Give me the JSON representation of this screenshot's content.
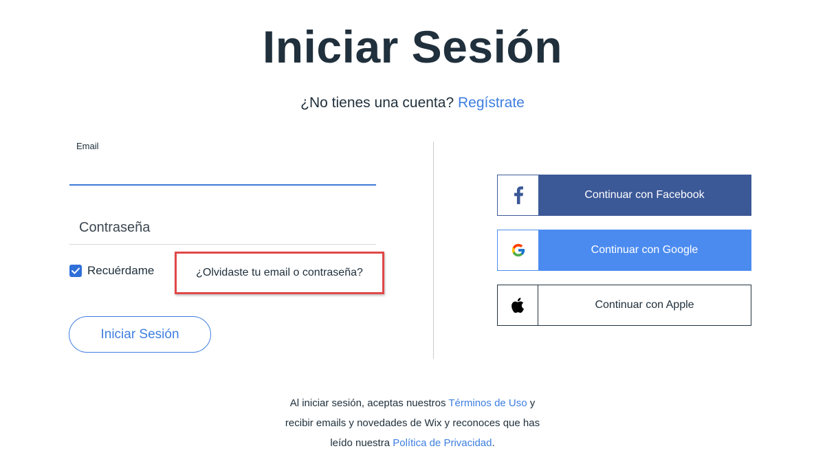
{
  "header": {
    "title": "Iniciar Sesión",
    "no_account_text": "¿No tienes una cuenta?",
    "signup_link": "Regístrate"
  },
  "form": {
    "email_label": "Email",
    "email_value": "",
    "password_placeholder": "Contraseña",
    "remember_label": "Recuérdame",
    "remember_checked": true,
    "forgot_link": "¿Olvidaste tu email o contraseña?",
    "login_button": "Iniciar Sesión"
  },
  "social": {
    "facebook": {
      "label": "Continuar con Facebook",
      "icon": "facebook-icon",
      "color": "#3b5897"
    },
    "google": {
      "label": "Continuar con Google",
      "icon": "google-icon",
      "color": "#4b8bf0"
    },
    "apple": {
      "label": "Continuar con Apple",
      "icon": "apple-icon",
      "color": "#ffffff"
    }
  },
  "terms": {
    "part1": "Al iniciar sesión, aceptas nuestros",
    "terms_link": "Términos de Uso",
    "part2": "y",
    "part3": "recibir emails y novedades de Wix y reconoces que has",
    "part4": "leído nuestra",
    "privacy_link": "Política de Privacidad",
    "part5": "."
  },
  "colors": {
    "accent": "#3d7ee0",
    "text": "#20303c",
    "highlight_box": "#e04848"
  }
}
